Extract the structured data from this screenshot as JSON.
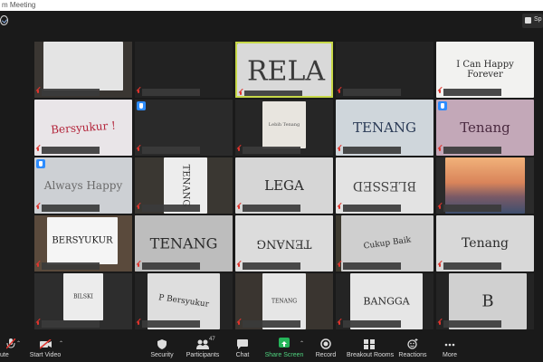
{
  "window": {
    "title": "m Meeting"
  },
  "top": {
    "view_label": "Sp"
  },
  "tiles": [
    {
      "row": 0,
      "col": 0,
      "text": "",
      "ink": "#7a7a7a",
      "hand": false,
      "active": false
    },
    {
      "row": 0,
      "col": 1,
      "text": "",
      "ink": "#333",
      "hand": false,
      "active": false
    },
    {
      "row": 0,
      "col": 2,
      "text": "RELA",
      "ink": "#3b3b3b",
      "hand": false,
      "active": true
    },
    {
      "row": 0,
      "col": 3,
      "text": "",
      "ink": "#333",
      "hand": false,
      "active": false
    },
    {
      "row": 0,
      "col": 4,
      "text": "I Can Happy Forever",
      "ink": "#2b2b2b",
      "hand": false,
      "active": false
    },
    {
      "row": 1,
      "col": 0,
      "text": "Bersyukur !",
      "ink": "#b3243a",
      "hand": false,
      "active": false
    },
    {
      "row": 1,
      "col": 1,
      "text": "",
      "ink": "#333",
      "hand": true,
      "active": false
    },
    {
      "row": 1,
      "col": 2,
      "text": "Lebih Tenang",
      "ink": "#555",
      "hand": false,
      "active": false
    },
    {
      "row": 1,
      "col": 3,
      "text": "TENANG",
      "ink": "#2a3a55",
      "hand": false,
      "active": false
    },
    {
      "row": 1,
      "col": 4,
      "text": "Tenang",
      "ink": "#4a2a40",
      "hand": true,
      "active": false
    },
    {
      "row": 2,
      "col": 0,
      "text": "Always Happy",
      "ink": "#6a6a6a",
      "hand": true,
      "active": false
    },
    {
      "row": 2,
      "col": 1,
      "text": "TENANG",
      "ink": "#2b2b2b",
      "hand": false,
      "active": false
    },
    {
      "row": 2,
      "col": 2,
      "text": "LEGA",
      "ink": "#2b2b2b",
      "hand": false,
      "active": false
    },
    {
      "row": 2,
      "col": 3,
      "text": "BLESSED",
      "ink": "#444",
      "hand": false,
      "active": false
    },
    {
      "row": 2,
      "col": 4,
      "text": "",
      "ink": "#333",
      "hand": false,
      "active": false
    },
    {
      "row": 3,
      "col": 0,
      "text": "BERSYUKUR",
      "ink": "#1a1a1a",
      "hand": false,
      "active": false
    },
    {
      "row": 3,
      "col": 1,
      "text": "TENANG",
      "ink": "#2b2b2b",
      "hand": false,
      "active": false
    },
    {
      "row": 3,
      "col": 2,
      "text": "TENANG",
      "ink": "#2b2b2b",
      "hand": false,
      "active": false
    },
    {
      "row": 3,
      "col": 3,
      "text": "Cukup Baik",
      "ink": "#2b2b2b",
      "hand": false,
      "active": false
    },
    {
      "row": 3,
      "col": 4,
      "text": "Tenang",
      "ink": "#2b2b2b",
      "hand": false,
      "active": false
    },
    {
      "row": 4,
      "col": 0,
      "text": "BILSKI",
      "ink": "#2b2b2b",
      "hand": false,
      "active": false
    },
    {
      "row": 4,
      "col": 1,
      "text": "P Bersyukur",
      "ink": "#2b2b2b",
      "hand": false,
      "active": false
    },
    {
      "row": 4,
      "col": 2,
      "text": "TENANG",
      "ink": "#2b2b2b",
      "hand": false,
      "active": false
    },
    {
      "row": 4,
      "col": 3,
      "text": "BANGGA",
      "ink": "#2b2b2b",
      "hand": false,
      "active": false
    },
    {
      "row": 4,
      "col": 4,
      "text": "B",
      "ink": "#2b2b2b",
      "hand": false,
      "active": false
    }
  ],
  "toolbar": {
    "mute": "ute",
    "start_video": "Start Video",
    "security": "Security",
    "participants": "Participants",
    "participants_count": "47",
    "chat": "Chat",
    "share_screen": "Share Screen",
    "record": "Record",
    "breakout_rooms": "Breakout Rooms",
    "reactions": "Reactions",
    "more": "More"
  },
  "colors": {
    "active_border": "#c7d848",
    "mic_muted": "#e0342d",
    "hand_raised": "#2d8cff",
    "share_green": "#25b55a"
  }
}
